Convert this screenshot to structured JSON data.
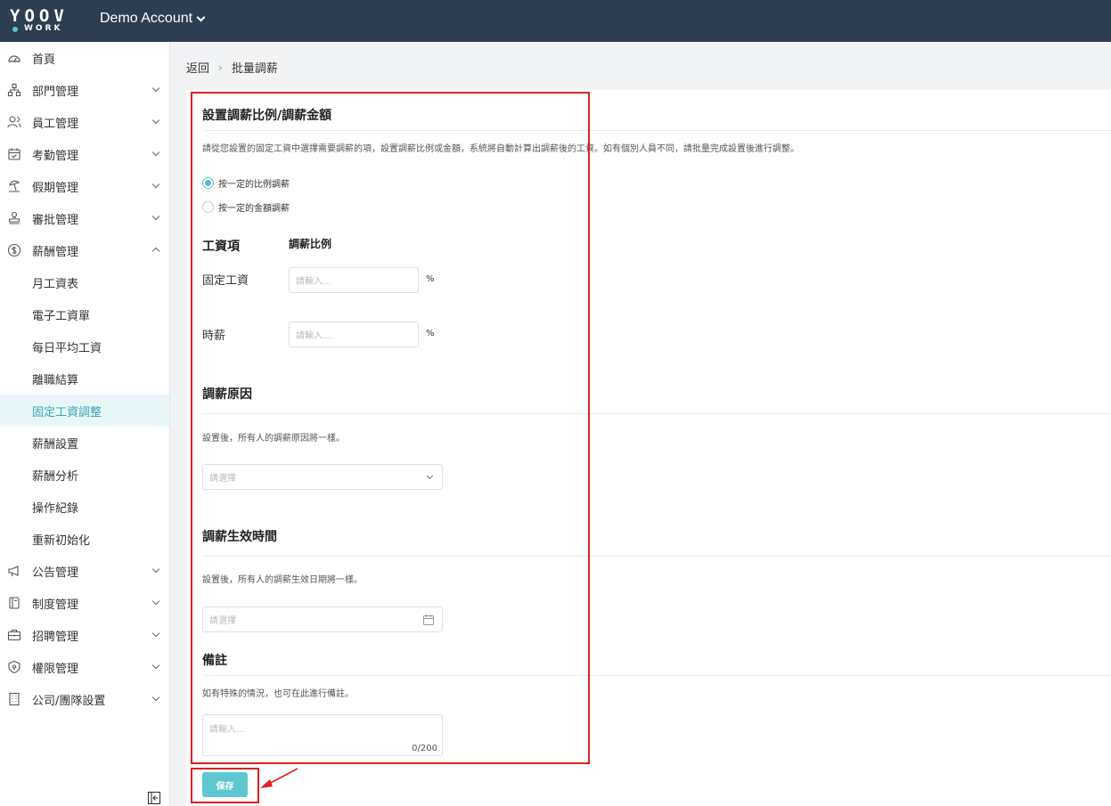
{
  "brand": {
    "logo_top": "YOOV",
    "logo_bottom": "WORK"
  },
  "header": {
    "account": "Demo Account"
  },
  "sidebar": {
    "items": [
      {
        "label": "首頁",
        "icon": "dashboard-icon",
        "arrow": ""
      },
      {
        "label": "部門管理",
        "icon": "org-chart-icon",
        "arrow": "down"
      },
      {
        "label": "員工管理",
        "icon": "users-icon",
        "arrow": "down"
      },
      {
        "label": "考勤管理",
        "icon": "calendar-check-icon",
        "arrow": "down"
      },
      {
        "label": "假期管理",
        "icon": "beach-icon",
        "arrow": "down"
      },
      {
        "label": "審批管理",
        "icon": "stamp-icon",
        "arrow": "down"
      },
      {
        "label": "薪酬管理",
        "icon": "dollar-icon",
        "arrow": "up"
      }
    ],
    "subitems": [
      "月工資表",
      "電子工資單",
      "每日平均工資",
      "離職結算",
      "固定工資調整",
      "薪酬設置",
      "薪酬分析",
      "操作紀錄",
      "重新初始化"
    ],
    "active_sub": "固定工資調整",
    "items_after": [
      {
        "label": "公告管理",
        "icon": "megaphone-icon"
      },
      {
        "label": "制度管理",
        "icon": "book-icon"
      },
      {
        "label": "招聘管理",
        "icon": "briefcase-icon"
      },
      {
        "label": "權限管理",
        "icon": "shield-icon"
      },
      {
        "label": "公司/團隊設置",
        "icon": "building-icon"
      }
    ]
  },
  "breadcrumb": {
    "back": "返回",
    "separator": "›",
    "current": "批量調薪"
  },
  "section1": {
    "title": "設置調薪比例/調薪金額",
    "desc": "請從您設置的固定工資中選擇需要調薪的項，設置調薪比例或金額，系統將自動計算出調薪後的工資。如有個別人員不同，請批量完成設置後進行調整。",
    "radio_ratio": "按一定的比例調薪",
    "radio_amount": "按一定的金額調薪",
    "selected": "ratio",
    "col_item": "工資項",
    "col_ratio": "調薪比例",
    "rows": [
      {
        "label": "固定工資",
        "placeholder": "請輸入...",
        "unit": "%"
      },
      {
        "label": "時薪",
        "placeholder": "請輸入...",
        "unit": "%"
      }
    ]
  },
  "section2": {
    "title": "調薪原因",
    "desc": "設置後，所有人的調薪原因將一樣。",
    "placeholder": "請選擇"
  },
  "section3": {
    "title": "調薪生效時間",
    "desc": "設置後，所有人的調薪生效日期將一樣。",
    "placeholder": "請選擇"
  },
  "section4": {
    "title": "備註",
    "desc": "如有特殊的情況，也可在此進行備註。",
    "placeholder": "請輸入...",
    "counter": "0/200"
  },
  "actions": {
    "save": "保存"
  },
  "colors": {
    "topbar": "#2d3e50",
    "accent": "#5ec7cf",
    "active_bg": "#e9f7f8",
    "highlight": "#e0201f"
  }
}
